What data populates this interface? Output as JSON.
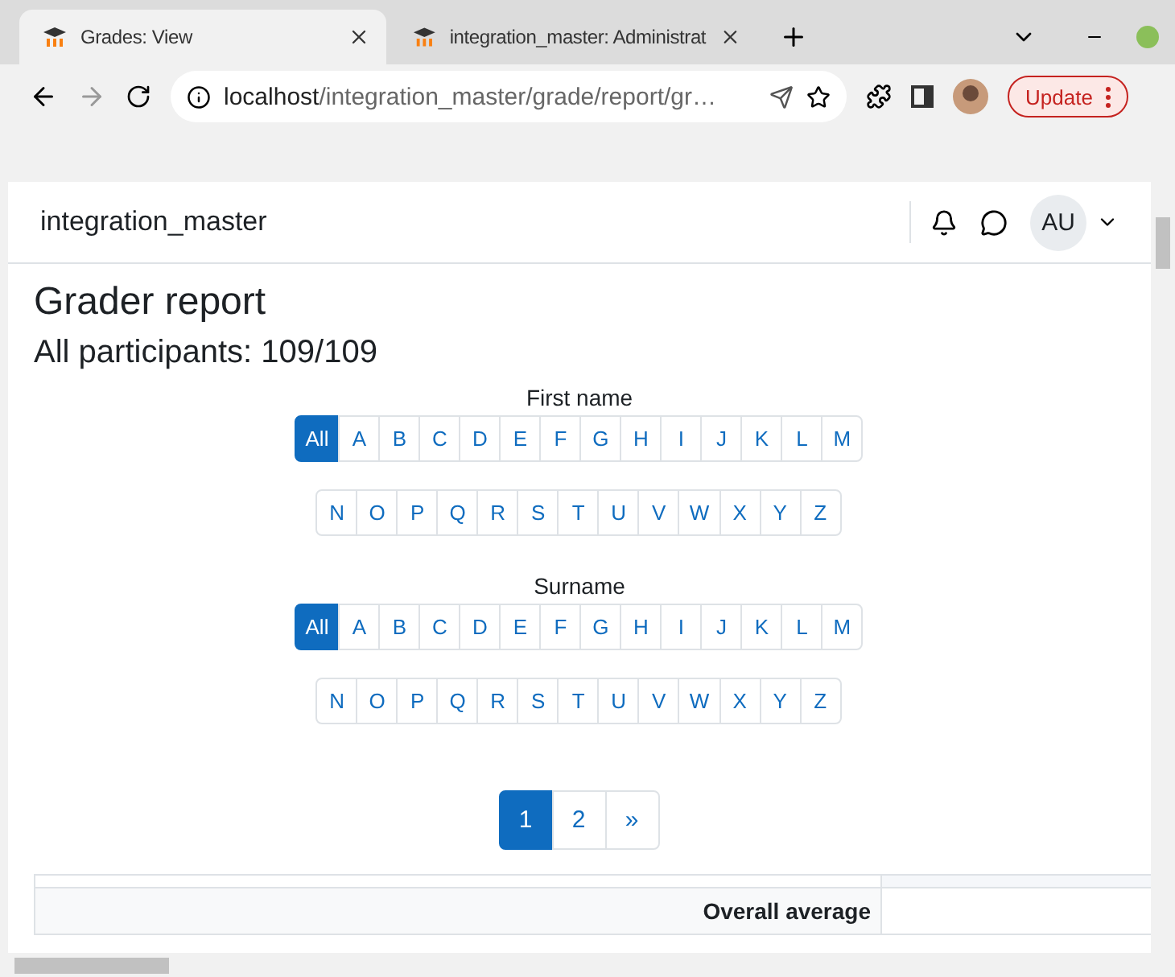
{
  "browser": {
    "tabs": [
      {
        "title": "Grades: View",
        "selected": true
      },
      {
        "title": "integration_master: Administrat",
        "selected": false
      }
    ],
    "address": {
      "host": "localhost",
      "path": "/integration_master/grade/report/gr…"
    },
    "update_button": "Update"
  },
  "navbar": {
    "site_name": "integration_master",
    "avatar": "AU"
  },
  "page": {
    "title": "Grader report",
    "subtitle": "All participants: 109/109"
  },
  "filters": [
    {
      "label": "First name",
      "rows": [
        [
          {
            "label": "All",
            "selected": true
          },
          {
            "label": "A",
            "selected": false
          },
          {
            "label": "B",
            "selected": false
          },
          {
            "label": "C",
            "selected": false
          },
          {
            "label": "D",
            "selected": false
          },
          {
            "label": "E",
            "selected": false
          },
          {
            "label": "F",
            "selected": false
          },
          {
            "label": "G",
            "selected": false
          },
          {
            "label": "H",
            "selected": false
          },
          {
            "label": "I",
            "selected": false
          },
          {
            "label": "J",
            "selected": false
          },
          {
            "label": "K",
            "selected": false
          },
          {
            "label": "L",
            "selected": false
          },
          {
            "label": "M",
            "selected": false
          }
        ],
        [
          {
            "label": "N",
            "selected": false
          },
          {
            "label": "O",
            "selected": false
          },
          {
            "label": "P",
            "selected": false
          },
          {
            "label": "Q",
            "selected": false
          },
          {
            "label": "R",
            "selected": false
          },
          {
            "label": "S",
            "selected": false
          },
          {
            "label": "T",
            "selected": false
          },
          {
            "label": "U",
            "selected": false
          },
          {
            "label": "V",
            "selected": false
          },
          {
            "label": "W",
            "selected": false
          },
          {
            "label": "X",
            "selected": false
          },
          {
            "label": "Y",
            "selected": false
          },
          {
            "label": "Z",
            "selected": false
          }
        ]
      ]
    },
    {
      "label": "Surname",
      "rows": [
        [
          {
            "label": "All",
            "selected": true
          },
          {
            "label": "A",
            "selected": false
          },
          {
            "label": "B",
            "selected": false
          },
          {
            "label": "C",
            "selected": false
          },
          {
            "label": "D",
            "selected": false
          },
          {
            "label": "E",
            "selected": false
          },
          {
            "label": "F",
            "selected": false
          },
          {
            "label": "G",
            "selected": false
          },
          {
            "label": "H",
            "selected": false
          },
          {
            "label": "I",
            "selected": false
          },
          {
            "label": "J",
            "selected": false
          },
          {
            "label": "K",
            "selected": false
          },
          {
            "label": "L",
            "selected": false
          },
          {
            "label": "M",
            "selected": false
          }
        ],
        [
          {
            "label": "N",
            "selected": false
          },
          {
            "label": "O",
            "selected": false
          },
          {
            "label": "P",
            "selected": false
          },
          {
            "label": "Q",
            "selected": false
          },
          {
            "label": "R",
            "selected": false
          },
          {
            "label": "S",
            "selected": false
          },
          {
            "label": "T",
            "selected": false
          },
          {
            "label": "U",
            "selected": false
          },
          {
            "label": "V",
            "selected": false
          },
          {
            "label": "W",
            "selected": false
          },
          {
            "label": "X",
            "selected": false
          },
          {
            "label": "Y",
            "selected": false
          },
          {
            "label": "Z",
            "selected": false
          }
        ]
      ]
    }
  ],
  "pagination": [
    {
      "label": "1",
      "selected": true
    },
    {
      "label": "2",
      "selected": false
    },
    {
      "label": "»",
      "selected": false
    }
  ],
  "table": {
    "row_header": "Overall average"
  }
}
